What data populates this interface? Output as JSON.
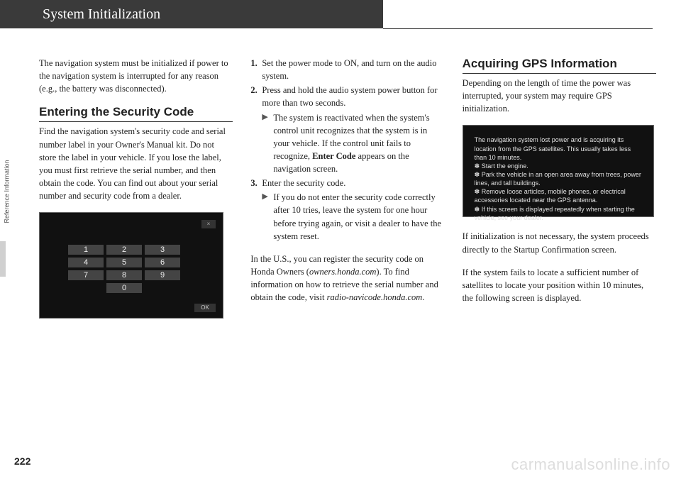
{
  "header": {
    "title": "System Initialization"
  },
  "sidebar": {
    "label": "Reference Information"
  },
  "page_number": "222",
  "watermark": "carmanualsonline.info",
  "col1": {
    "intro": "The navigation system must be initialized if power to the navigation system is interrupted for any reason (e.g., the battery was disconnected).",
    "heading": "Entering the Security Code",
    "body": "Find the navigation system's security code and serial number label in your Owner's Manual kit. Do not store the label in your vehicle. If you lose the label, you must first retrieve the serial number, and then obtain the code. You can find out about your serial number and security code from a dealer.",
    "keypad": {
      "keys": [
        "1",
        "2",
        "3",
        "4",
        "5",
        "6",
        "7",
        "8",
        "9",
        "0"
      ],
      "x": "×",
      "ok": "OK"
    }
  },
  "col2": {
    "step1_num": "1.",
    "step1": "Set the power mode to ON, and turn on the audio system.",
    "step2_num": "2.",
    "step2": "Press and hold the audio system power button for more than two seconds.",
    "step2_sub_a": "The system is reactivated when the system's control unit recognizes that the system is in your vehicle. If the control unit fails to recognize, ",
    "step2_sub_bold": "Enter Code",
    "step2_sub_b": " appears on the navigation screen.",
    "step3_num": "3.",
    "step3": "Enter the security code.",
    "step3_sub": "If you do not enter the security code correctly after 10 tries, leave the system for one hour before trying again, or visit a dealer to have the system reset.",
    "us_a": "In the U.S., you can register the security code on Honda Owners (",
    "us_site1": "owners.honda.com",
    "us_b": "). To find information on how to retrieve the serial number and obtain the code, visit ",
    "us_site2": "radio-navicode.honda.com",
    "us_c": "."
  },
  "col3": {
    "heading": "Acquiring GPS Information",
    "intro": "Depending on the length of time the power was interrupted, your system may require GPS initialization.",
    "screen_text": "The navigation system lost power and is acquiring its location from the GPS satellites. This usually takes less than 10 minutes.\n✽ Start the engine.\n✽ Park the vehicle in an open area away from trees, power lines, and tall buildings.\n✽ Remove loose articles, mobile phones, or electrical accessories located near the GPS antenna.\n✽ If this screen is displayed repeatedly when starting the vehicle, see your dealer.",
    "after1": "If initialization is not necessary, the system proceeds directly to the Startup Confirmation screen.",
    "after2": "If the system fails to locate a sufficient number of satellites to locate your position within 10 minutes, the following screen is displayed."
  }
}
